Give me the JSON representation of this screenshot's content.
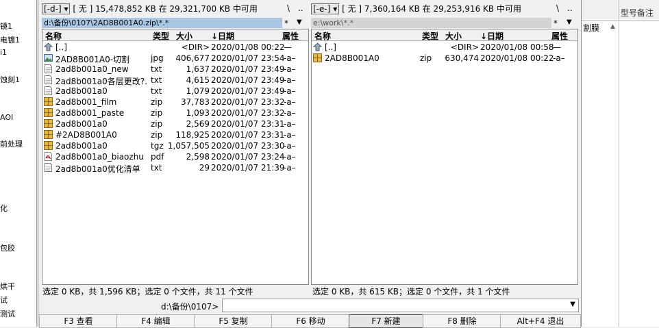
{
  "left_strip_labels": [
    "镜1",
    "电镀1",
    "i1",
    "蚀刻1",
    "",
    "AOI",
    "前处理",
    "",
    "化",
    "",
    "包胶",
    "",
    "烘干",
    "试",
    "测试"
  ],
  "left": {
    "drive": "[-d-]",
    "volume": "[ 无 ]",
    "free_text": "15,478,852 KB 在 29,321,700 KB 中可用",
    "root_btn": "\\",
    "up_btn": "..",
    "path": "d:\\备份\\0107\\2AD8B001A0.zip\\*.*",
    "filter_star": "*",
    "columns": [
      "名称",
      "类型",
      "大小",
      "↓日期",
      "属性"
    ],
    "rows": [
      {
        "icon": "updir",
        "name": "[..]",
        "type": "",
        "size": "<DIR>",
        "date": "2020/01/08 00:22",
        "attr": "—"
      },
      {
        "icon": "image",
        "name": "2AD8B001A0-切割",
        "type": "jpg",
        "size": "406,677",
        "date": "2020/01/07 23:54",
        "attr": "-a–"
      },
      {
        "icon": "text",
        "name": "2ad8b001a0_new",
        "type": "txt",
        "size": "1,637",
        "date": "2020/01/07 23:49",
        "attr": "-a–"
      },
      {
        "icon": "text",
        "name": "2ad8b001a0各层更改?.",
        "type": "txt",
        "size": "4,615",
        "date": "2020/01/07 23:49",
        "attr": "-a–"
      },
      {
        "icon": "text",
        "name": "2ad8b001a0",
        "type": "txt",
        "size": "1,079",
        "date": "2020/01/07 23:49",
        "attr": "-a–"
      },
      {
        "icon": "archive",
        "name": "2ad8b001_film",
        "type": "zip",
        "size": "37,783",
        "date": "2020/01/07 23:32",
        "attr": "-a–"
      },
      {
        "icon": "archive",
        "name": "2ad8b001_paste",
        "type": "zip",
        "size": "1,093",
        "date": "2020/01/07 23:32",
        "attr": "-a–"
      },
      {
        "icon": "archive",
        "name": "2ad8b001a0",
        "type": "zip",
        "size": "2,569",
        "date": "2020/01/07 23:31",
        "attr": "-a–"
      },
      {
        "icon": "archive",
        "name": "#2AD8B001A0",
        "type": "zip",
        "size": "118,925",
        "date": "2020/01/07 23:31",
        "attr": "-a–"
      },
      {
        "icon": "archive",
        "name": "2ad8b001a0",
        "type": "tgz",
        "size": "1,057,505",
        "date": "2020/01/07 23:30",
        "attr": "-a–"
      },
      {
        "icon": "pdf",
        "name": "2ad8b001a0_biaozhu",
        "type": "pdf",
        "size": "2,598",
        "date": "2020/01/07 23:24",
        "attr": "-a–"
      },
      {
        "icon": "text",
        "name": "2ad8b001a0优化清单",
        "type": "txt",
        "size": "29",
        "date": "2020/01/07 21:39",
        "attr": "-a–"
      }
    ],
    "status": "选定 0 KB，共 1,596 KB；选定 0 个文件，共 11 个文件"
  },
  "right": {
    "drive": "[-e-]",
    "volume": "[ 无 ]",
    "free_text": "7,360,164 KB 在 29,253,916 KB 中可用",
    "root_btn": "\\",
    "up_btn": "..",
    "path": "e:\\work\\*.*",
    "filter_star": "*",
    "columns": [
      "名称",
      "类型",
      "大小",
      "↓日期",
      "属性"
    ],
    "rows": [
      {
        "icon": "updir",
        "name": "[..]",
        "type": "",
        "size": "<DIR>",
        "date": "2020/01/08 00:58",
        "attr": "—"
      },
      {
        "icon": "archive",
        "name": "2AD8B001A0",
        "type": "zip",
        "size": "630,474",
        "date": "2020/01/08 00:22",
        "attr": "-a–"
      }
    ],
    "status": "选定 0 KB，共 615 KB；选定 0 个文件，共 1 个文件"
  },
  "cmdline": {
    "prompt": "d:\\备份\\0107>",
    "value": ""
  },
  "fkeys": [
    "F3 查看",
    "F4 编辑",
    "F5 复制",
    "F6 移动",
    "F7 新建",
    "F8 删除",
    "Alt+F4 退出"
  ],
  "rightpanel": {
    "header": "型号备注",
    "cell": "割膜"
  },
  "colors": {
    "pathbar_active": "#a9c6e3",
    "pathbar_inactive": "#d4d4d4",
    "archive_icon": "#e8b84a"
  }
}
